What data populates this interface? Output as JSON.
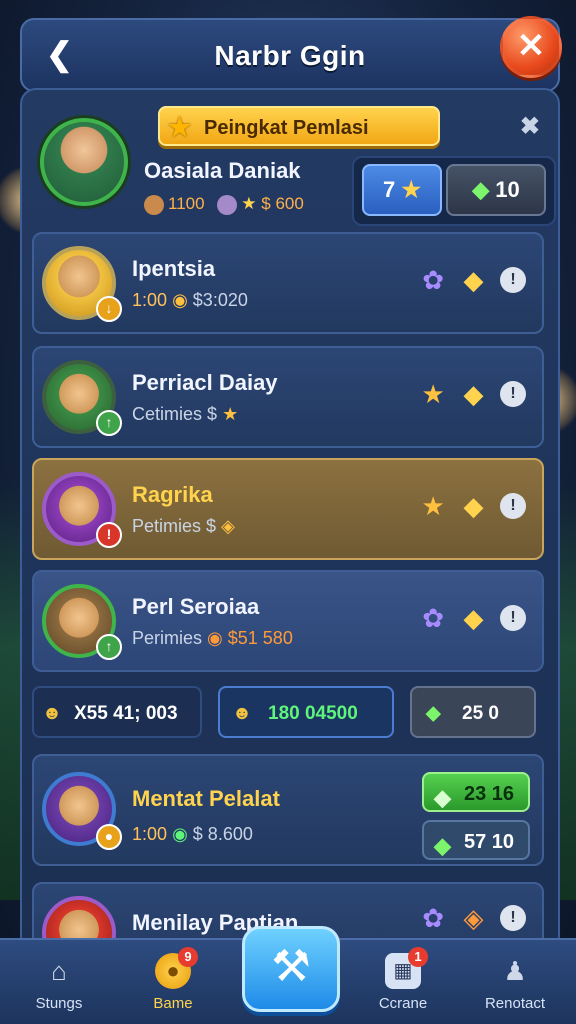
{
  "header": {
    "title": "Narbr Ggin",
    "back_icon": "chevron-left-icon",
    "close_icon": "close-icon"
  },
  "player": {
    "rank_banner": "Peingkat Pemlasi",
    "name": "Oasiala Daniak",
    "stat1": "1100",
    "stat2": "$ 600",
    "box_blue": "7",
    "box_dark": "10"
  },
  "rows": [
    {
      "name": "Ipentsia",
      "sub1": "1:00",
      "sub2": "$3:020"
    },
    {
      "name": "Perriacl Daiay",
      "sub1": "Cetimies",
      "sub2": "$"
    },
    {
      "name": "Ragrika",
      "sub1": "Petimies",
      "sub2": "$"
    },
    {
      "name": "Perl Seroiaa",
      "sub1": "Perimies",
      "sub2": "$51 580"
    }
  ],
  "strip": {
    "pill_a": "X55 41; 003",
    "pill_b": "180 04500",
    "pill_c": "25 0"
  },
  "row5": {
    "name": "Mentat Pelalat",
    "sub1": "1:00",
    "sub2": "$ 8.600",
    "green": "23 16",
    "dark": "57 10"
  },
  "row6": {
    "name": "Menilay Paptian"
  },
  "nav": {
    "item1": "Stungs",
    "item2": "Bame",
    "item2_badge": "9",
    "item4": "Ccrane",
    "item4_badge": "1",
    "item5": "Renotact"
  }
}
